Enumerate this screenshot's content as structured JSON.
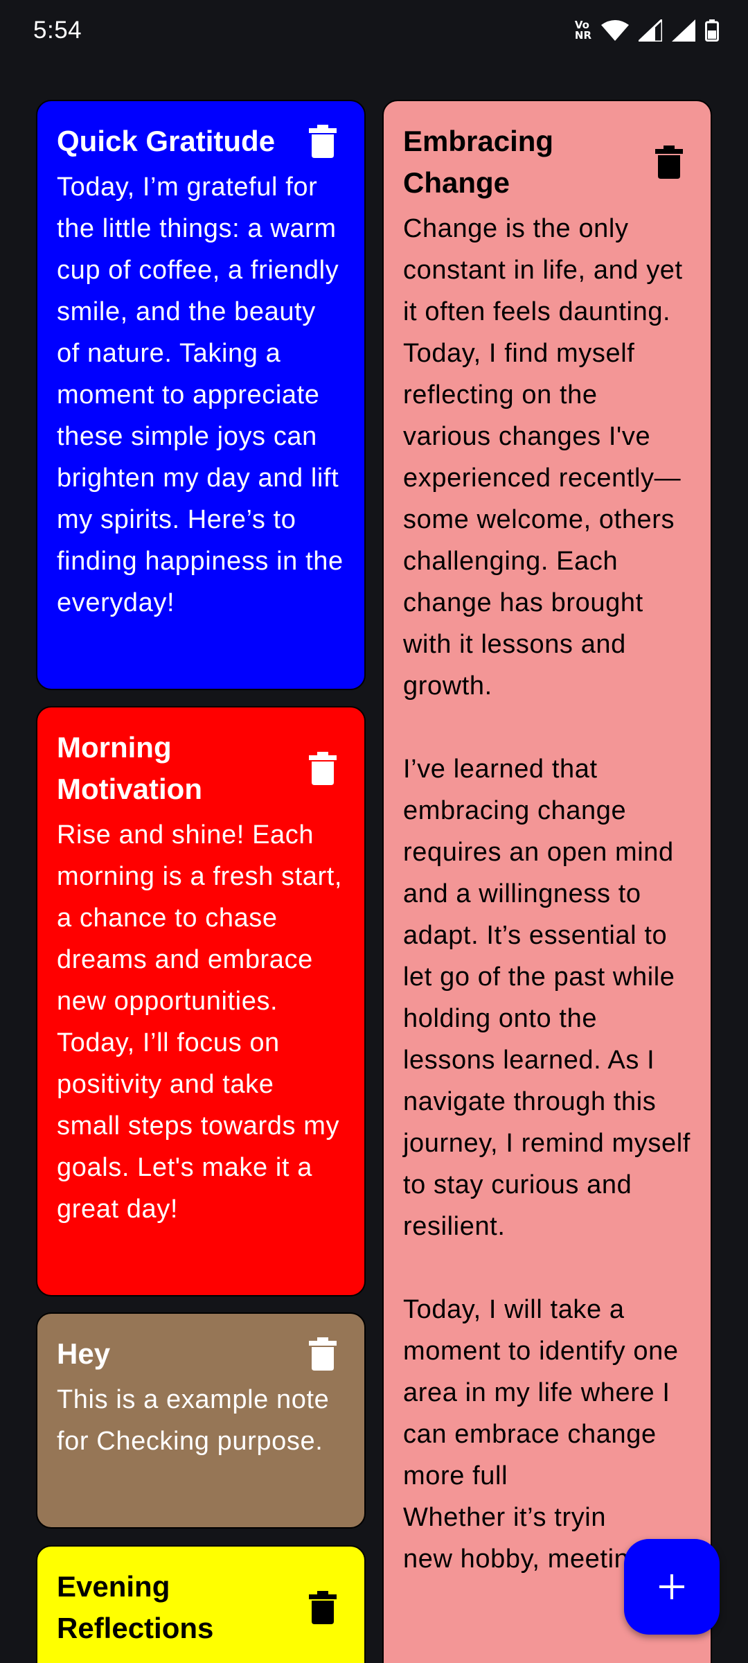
{
  "status_bar": {
    "time": "5:54",
    "volte_top": "Vo",
    "volte_bottom": "NR",
    "icons": [
      "volte-nr-icon",
      "wifi-icon",
      "cell-signal-icon",
      "cell-signal-icon",
      "battery-icon"
    ]
  },
  "notes": [
    {
      "title": "Quick Gratitude",
      "body": "Today, I’m grateful for the little things: a warm cup of coffee, a friendly smile, and the beauty of nature. Taking a moment to appreciate these simple joys can brighten my day and lift my spirits. Here’s to finding happiness in the everyday!",
      "color": "#0000ff",
      "text_color": "#ffffff",
      "icon": "trash-icon"
    },
    {
      "title": "Embracing Change",
      "body": "Change is the only constant in life, and yet it often feels daunting. Today, I find myself reflecting on the various changes I've experienced recently—some welcome, others challenging. Each change has brought with it lessons and growth.\n\nI’ve learned that embracing change requires an open mind and a willingness to adapt. It’s essential to let go of the past while holding onto the lessons learned. As I navigate through this journey, I remind myself to stay curious and resilient.\n\nToday, I will take a moment to identify one area in my life where I can embrace change more full",
      "body_tail_1": "Whether it’s tryin",
      "body_tail_2": "new hobby, meeting",
      "color": "#f39696",
      "text_color": "#000000",
      "icon": "trash-icon"
    },
    {
      "title": "Morning Motivation",
      "body": "Rise and shine! Each morning is a fresh start, a chance to chase dreams and embrace new opportunities. Today, I’ll focus on positivity and take small steps towards my goals. Let's make it a great day!",
      "color": "#ff0000",
      "text_color": "#ffffff",
      "icon": "trash-icon"
    },
    {
      "title": "Hey",
      "body": "This is a example note for Checking purpose.",
      "color": "#967656",
      "text_color": "#ffffff",
      "icon": "trash-icon"
    },
    {
      "title": "Evening Reflections",
      "body": "",
      "color": "#ffff00",
      "text_color": "#000000",
      "icon": "trash-icon"
    }
  ],
  "fab": {
    "icon": "plus-icon",
    "color": "#0000ff"
  }
}
